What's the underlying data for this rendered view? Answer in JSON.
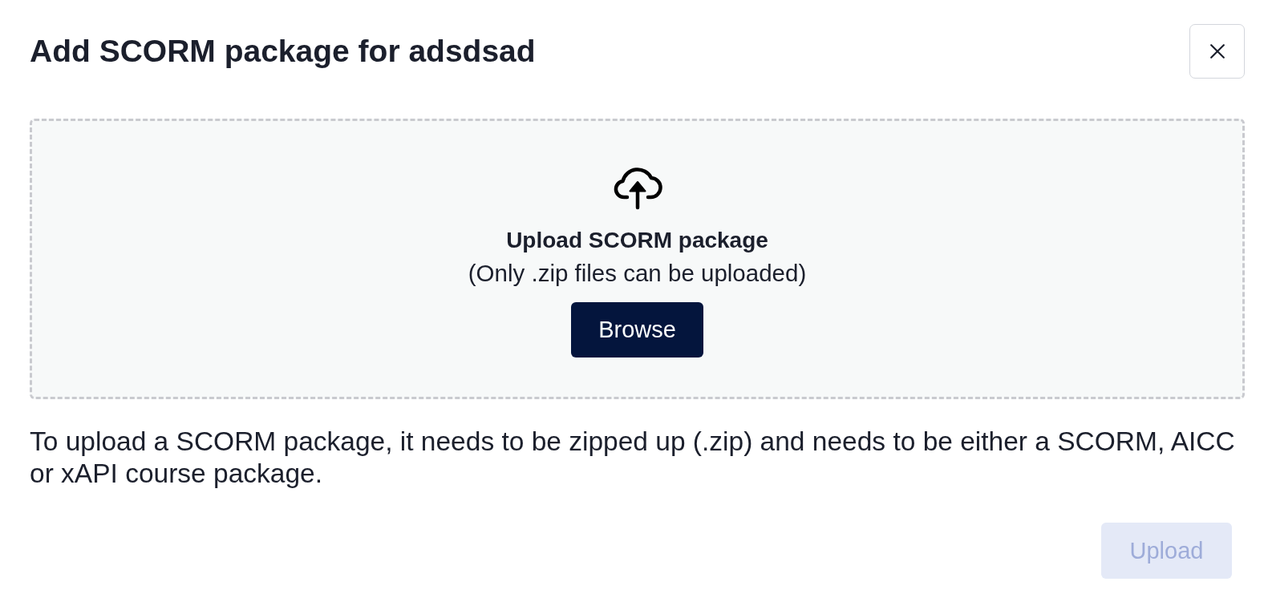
{
  "dialog": {
    "title": "Add SCORM package for adsdsad"
  },
  "dropzone": {
    "heading": "Upload SCORM package",
    "hint": "(Only .zip files can be uploaded)",
    "browse_button": "Browse"
  },
  "description": "To upload a SCORM package, it needs to be zipped up (.zip) and needs to be either a SCORM, AICC or xAPI course package.",
  "footer": {
    "upload_button": {
      "label": "Upload",
      "disabled": true
    }
  }
}
